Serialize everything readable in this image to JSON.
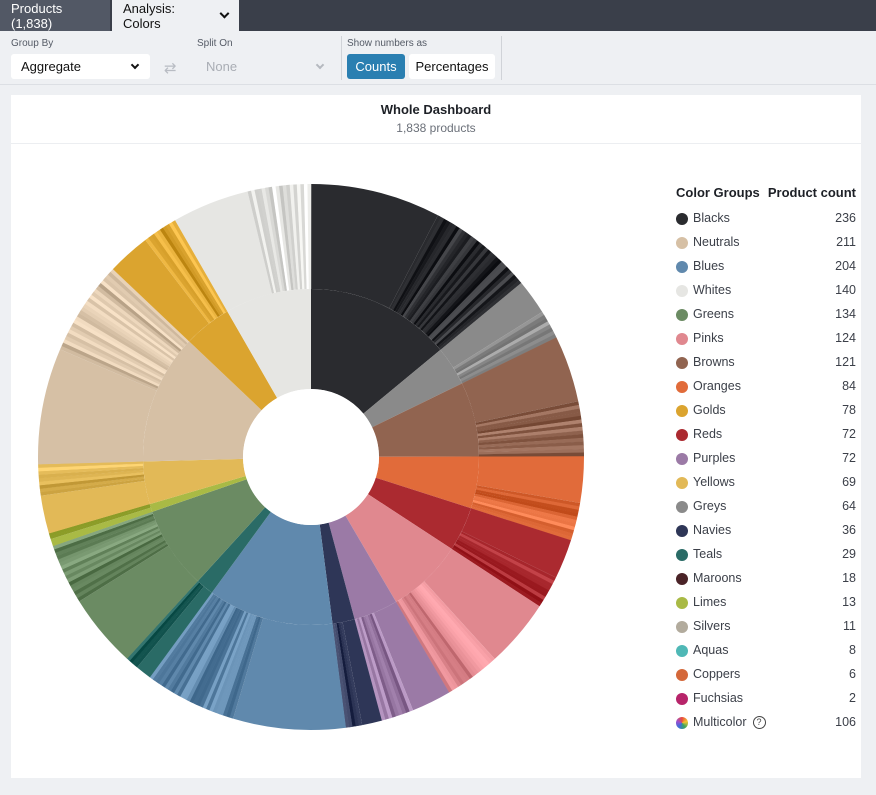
{
  "tabs": [
    {
      "label": "Products (1,838)"
    },
    {
      "label": "Analysis: Colors"
    }
  ],
  "toolbar": {
    "group_by_label": "Group By",
    "group_by_value": "Aggregate",
    "split_on_label": "Split On",
    "split_on_value": "None",
    "show_numbers_label": "Show numbers as",
    "counts_label": "Counts",
    "percentages_label": "Percentages",
    "selected_mode": "Counts"
  },
  "chart_data": {
    "type": "pie",
    "title": "Whole Dashboard",
    "subtitle": "1,838 products",
    "legend_header": [
      "Color Groups",
      "Product count"
    ],
    "legend_position": "right",
    "categories": [
      "Blacks",
      "Neutrals",
      "Blues",
      "Whites",
      "Greens",
      "Pinks",
      "Browns",
      "Oranges",
      "Golds",
      "Reds",
      "Purples",
      "Yellows",
      "Greys",
      "Navies",
      "Teals",
      "Maroons",
      "Limes",
      "Silvers",
      "Aquas",
      "Coppers",
      "Fuchsias",
      "Multicolor"
    ],
    "values": [
      236,
      211,
      204,
      140,
      134,
      124,
      121,
      84,
      78,
      72,
      72,
      69,
      64,
      36,
      29,
      18,
      13,
      11,
      8,
      6,
      2,
      106
    ],
    "colors": [
      "#2a2b2f",
      "#d6c0a5",
      "#6089ad",
      "#e6e6e3",
      "#6b8b63",
      "#e0888f",
      "#916450",
      "#e16b3a",
      "#dba42f",
      "#ab2a30",
      "#9b7aa6",
      "#e2b957",
      "#8a8a8a",
      "#2e3657",
      "#2a6b66",
      "#4a2327",
      "#a9ba45",
      "#b2ab9d",
      "#4fb8b6",
      "#d4683a",
      "#b7246a",
      "#multicolor"
    ],
    "ring_order": [
      "Blacks",
      "Greys",
      "Browns",
      "Oranges",
      "Reds",
      "Maroons",
      "Fuchsias",
      "Pinks",
      "Purples",
      "Navies",
      "Blues",
      "Aquas",
      "Teals",
      "Greens",
      "Limes",
      "Yellows",
      "Golds",
      "Neutrals",
      "Silvers",
      "Coppers",
      "Golds",
      "Whites"
    ],
    "inner_order": [
      "Blacks",
      "Greys",
      "Browns",
      "Oranges",
      "Reds",
      "Pinks",
      "Purples",
      "Navies",
      "Blues",
      "Teals",
      "Greens",
      "Limes",
      "Yellows",
      "Neutrals",
      "Golds",
      "Whites"
    ]
  }
}
